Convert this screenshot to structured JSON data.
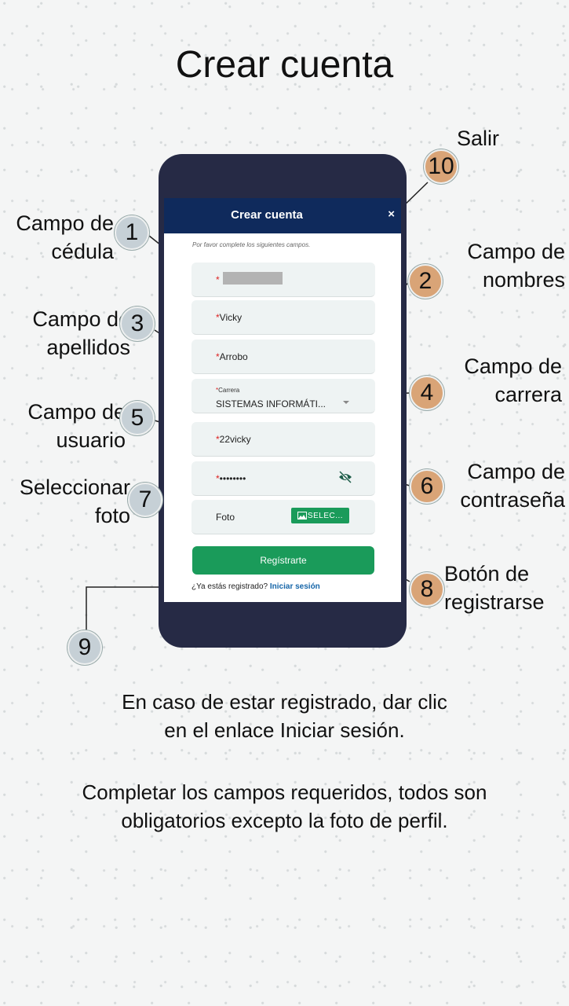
{
  "page_title": "Crear cuenta",
  "callouts": {
    "exit": {
      "number": "10",
      "label": "Salir"
    },
    "id_field": {
      "number": "1",
      "line1": "Campo de",
      "line2": "cédula"
    },
    "names_field": {
      "number": "2",
      "line1": "Campo de",
      "line2": "nombres"
    },
    "surnames_field": {
      "number": "3",
      "line1": "Campo de",
      "line2": "apellidos"
    },
    "career_field": {
      "number": "4",
      "line1": "Campo de",
      "line2": "carrera"
    },
    "user_field": {
      "number": "5",
      "line1": "Campo de",
      "line2": "usuario"
    },
    "password_field": {
      "number": "6",
      "line1": "Campo de",
      "line2": "contraseña"
    },
    "photo": {
      "number": "7",
      "line1": "Seleccionar",
      "line2": "foto"
    },
    "register_button": {
      "number": "8",
      "line1": "Botón de",
      "line2": "registrarse"
    },
    "login_link": {
      "number": "9"
    }
  },
  "app": {
    "header_title": "Crear cuenta",
    "close_symbol": "×",
    "instructions": "Por favor complete los siguientes campos.",
    "fields": {
      "required_mark": "*",
      "names": "Vicky",
      "surnames": "Arrobo",
      "career_label": "Carrera",
      "career_value": "SISTEMAS INFORMÁTI...",
      "username": "22vicky",
      "password": "••••••••",
      "photo_label": "Foto",
      "photo_button": "SELEC..."
    },
    "register_label": "Regístrarte",
    "login_prompt": "¿Ya estás registrado?",
    "login_link": "Iniciar sesión"
  },
  "footer": {
    "line1": "En caso de estar registrado, dar clic",
    "line2": "en el enlace Iniciar sesión.",
    "line3": "Completar los campos requeridos, todos son",
    "line4": "obligatorios excepto la foto de perfil."
  },
  "colors": {
    "header": "#0f2a5c",
    "accent_green": "#1a9b5a",
    "phone_body": "#262a45",
    "badge_gray": "#c6d0d6",
    "badge_orange": "#d9a477",
    "link": "#1565a8"
  }
}
